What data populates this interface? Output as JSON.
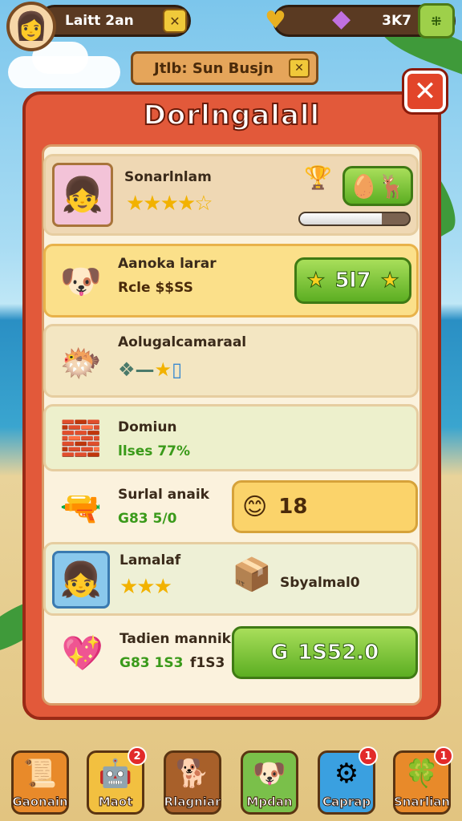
{
  "hud": {
    "player_name": "Laitt 2an",
    "close_glyph": "✕",
    "currency_value": "3K7",
    "menu_glyph": "⁜"
  },
  "sub_tab": {
    "label": "Jtlb: Sun Busjn",
    "close_glyph": "✕"
  },
  "panel": {
    "title": "Dorlngalall",
    "close_glyph": "✕"
  },
  "rows": [
    {
      "title": "Sonarlnlam",
      "stars": "★★★★☆",
      "progress": 0.75,
      "icon": "girl-portrait-icon",
      "action_icon": "egg-and-animal-icon"
    },
    {
      "title": "Aanoka larar",
      "subtitle": "Rcle $$SS",
      "button_label": "5l7",
      "icon": "dog-icon"
    },
    {
      "title": "Aolugalcamaraal",
      "icon": "golden-creature-icon",
      "reward_icons": "gem-dash-star-cup"
    },
    {
      "title": "Domiun",
      "subtitle": "llses 77%",
      "icon": "building-blocks-icon"
    },
    {
      "title": "Surlal anaik",
      "subtitle": "G83 5/0",
      "button_label": "18",
      "icon": "cannon-icon"
    },
    {
      "title": "Lamalaf",
      "stars": "★★★",
      "reward_label": "Sbyalmal0",
      "icon": "girl-portrait-icon"
    },
    {
      "title": "Tadien mannikl",
      "subtitle_a": "G83 1S3",
      "subtitle_b": "f1S3",
      "button_label": "1S52.0",
      "button_prefix": "G",
      "icon": "heart-gem-icon"
    }
  ],
  "nav": [
    {
      "label": "Gaonain",
      "badge": ""
    },
    {
      "label": "Maot",
      "badge": "2"
    },
    {
      "label": "Rlagniar",
      "badge": ""
    },
    {
      "label": "Mpdan",
      "badge": ""
    },
    {
      "label": "Caprap",
      "badge": "1"
    },
    {
      "label": "Snarlian",
      "badge": "1"
    }
  ],
  "colors": {
    "panel_red": "#e2593a",
    "green": "#5cae22",
    "gold": "#fbd36a",
    "cream": "#fbf2dd"
  }
}
